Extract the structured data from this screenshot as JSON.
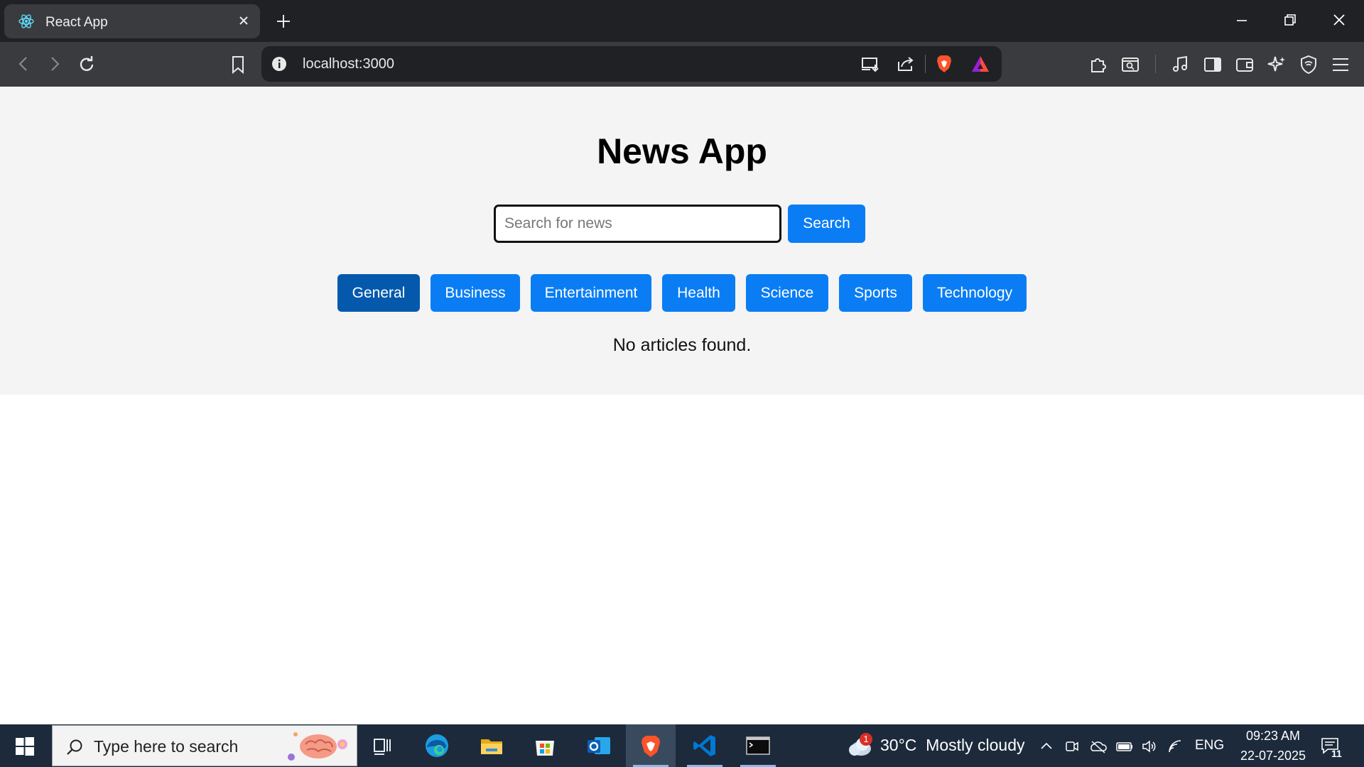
{
  "browser": {
    "tab": {
      "title": "React App",
      "favicon": "react-logo-icon"
    },
    "url": "localhost:3000"
  },
  "app": {
    "title": "News App",
    "search": {
      "placeholder": "Search for news",
      "value": "",
      "button_label": "Search"
    },
    "categories": [
      {
        "label": "General",
        "active": true
      },
      {
        "label": "Business",
        "active": false
      },
      {
        "label": "Entertainment",
        "active": false
      },
      {
        "label": "Health",
        "active": false
      },
      {
        "label": "Science",
        "active": false
      },
      {
        "label": "Sports",
        "active": false
      },
      {
        "label": "Technology",
        "active": false
      }
    ],
    "empty_message": "No articles found.",
    "colors": {
      "button": "#0a7df4",
      "button_active": "#0459ad",
      "background": "#f4f4f4"
    }
  },
  "taskbar": {
    "search_placeholder": "Type here to search",
    "apps": [
      "task-view-icon",
      "edge-icon",
      "file-explorer-icon",
      "microsoft-store-icon",
      "outlook-icon",
      "brave-icon",
      "vscode-icon",
      "terminal-icon"
    ],
    "active_app": "brave-icon",
    "weather": {
      "temp": "30°C",
      "condition": "Mostly cloudy",
      "badge": "1"
    },
    "language": "ENG",
    "time": "09:23 AM",
    "date": "22-07-2025",
    "notifications": "11"
  }
}
